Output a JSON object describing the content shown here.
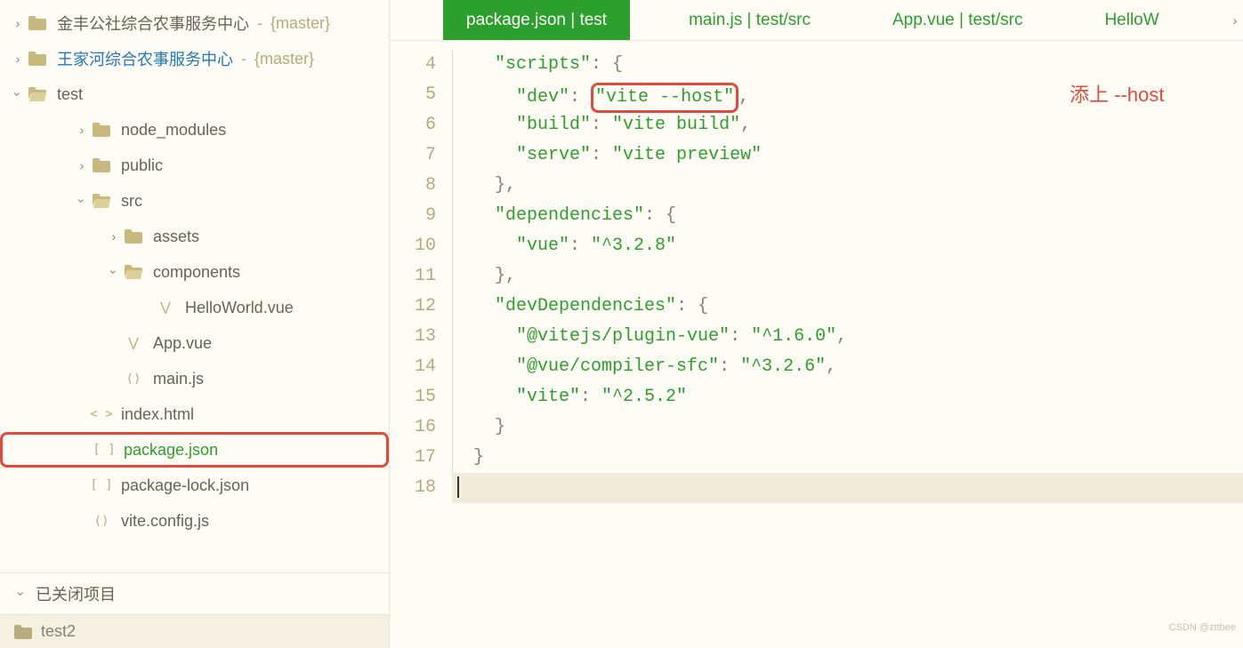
{
  "sidebar": {
    "projects": [
      {
        "name": "金丰公社综合农事服务中心",
        "branch": "{master}",
        "collapsed": true,
        "blue": false
      },
      {
        "name": "王家河综合农事服务中心",
        "branch": "{master}",
        "collapsed": true,
        "blue": true
      }
    ],
    "openProject": {
      "name": "test",
      "children": [
        {
          "name": "node_modules",
          "type": "folder",
          "indent": 2,
          "collapsed": true
        },
        {
          "name": "public",
          "type": "folder",
          "indent": 2,
          "collapsed": true
        },
        {
          "name": "src",
          "type": "folder",
          "indent": 2,
          "collapsed": false,
          "children": [
            {
              "name": "assets",
              "type": "folder",
              "indent": 3,
              "collapsed": true
            },
            {
              "name": "components",
              "type": "folder",
              "indent": 3,
              "collapsed": false,
              "children": [
                {
                  "name": "HelloWorld.vue",
                  "type": "vue",
                  "indent": 4
                }
              ]
            },
            {
              "name": "App.vue",
              "type": "vue",
              "indent": 3
            },
            {
              "name": "main.js",
              "type": "js",
              "indent": 3
            }
          ]
        },
        {
          "name": "index.html",
          "type": "html",
          "indent": 2
        },
        {
          "name": "package.json",
          "type": "json",
          "indent": 2,
          "selected": true
        },
        {
          "name": "package-lock.json",
          "type": "json",
          "indent": 2
        },
        {
          "name": "vite.config.js",
          "type": "js",
          "indent": 2
        }
      ]
    },
    "closedProjectsLabel": "已关闭项目",
    "closedProjects": [
      {
        "name": "test2"
      }
    ]
  },
  "tabs": [
    {
      "label": "package.json | test",
      "active": true
    },
    {
      "label": "main.js | test/src",
      "active": false
    },
    {
      "label": "App.vue | test/src",
      "active": false
    },
    {
      "label": "HelloW",
      "active": false
    }
  ],
  "code": {
    "startLine": 4,
    "lines": [
      {
        "n": 4,
        "indent": 2,
        "content": [
          {
            "t": "key",
            "v": "\"scripts\""
          },
          {
            "t": "punc",
            "v": ": {"
          }
        ]
      },
      {
        "n": 5,
        "indent": 3,
        "content": [
          {
            "t": "key",
            "v": "\"dev\""
          },
          {
            "t": "punc",
            "v": ": "
          },
          {
            "t": "hi",
            "v": "\"vite --host\""
          },
          {
            "t": "punc",
            "v": ","
          }
        ],
        "annotation": "添上 --host"
      },
      {
        "n": 6,
        "indent": 3,
        "content": [
          {
            "t": "key",
            "v": "\"build\""
          },
          {
            "t": "punc",
            "v": ": "
          },
          {
            "t": "str",
            "v": "\"vite build\""
          },
          {
            "t": "punc",
            "v": ","
          }
        ]
      },
      {
        "n": 7,
        "indent": 3,
        "content": [
          {
            "t": "key",
            "v": "\"serve\""
          },
          {
            "t": "punc",
            "v": ": "
          },
          {
            "t": "str",
            "v": "\"vite preview\""
          }
        ]
      },
      {
        "n": 8,
        "indent": 2,
        "content": [
          {
            "t": "punc",
            "v": "},"
          }
        ]
      },
      {
        "n": 9,
        "indent": 2,
        "content": [
          {
            "t": "key",
            "v": "\"dependencies\""
          },
          {
            "t": "punc",
            "v": ": {"
          }
        ]
      },
      {
        "n": 10,
        "indent": 3,
        "content": [
          {
            "t": "key",
            "v": "\"vue\""
          },
          {
            "t": "punc",
            "v": ": "
          },
          {
            "t": "str",
            "v": "\"^3.2.8\""
          }
        ]
      },
      {
        "n": 11,
        "indent": 2,
        "content": [
          {
            "t": "punc",
            "v": "},"
          }
        ]
      },
      {
        "n": 12,
        "indent": 2,
        "content": [
          {
            "t": "key",
            "v": "\"devDependencies\""
          },
          {
            "t": "punc",
            "v": ": {"
          }
        ]
      },
      {
        "n": 13,
        "indent": 3,
        "content": [
          {
            "t": "key",
            "v": "\"@vitejs/plugin-vue\""
          },
          {
            "t": "punc",
            "v": ": "
          },
          {
            "t": "str",
            "v": "\"^1.6.0\""
          },
          {
            "t": "punc",
            "v": ","
          }
        ]
      },
      {
        "n": 14,
        "indent": 3,
        "content": [
          {
            "t": "key",
            "v": "\"@vue/compiler-sfc\""
          },
          {
            "t": "punc",
            "v": ": "
          },
          {
            "t": "str",
            "v": "\"^3.2.6\""
          },
          {
            "t": "punc",
            "v": ","
          }
        ]
      },
      {
        "n": 15,
        "indent": 3,
        "content": [
          {
            "t": "key",
            "v": "\"vite\""
          },
          {
            "t": "punc",
            "v": ": "
          },
          {
            "t": "str",
            "v": "\"^2.5.2\""
          }
        ]
      },
      {
        "n": 16,
        "indent": 2,
        "content": [
          {
            "t": "punc",
            "v": "}"
          }
        ]
      },
      {
        "n": 17,
        "indent": 1,
        "content": [
          {
            "t": "punc",
            "v": "}"
          }
        ]
      },
      {
        "n": 18,
        "indent": 0,
        "content": [],
        "current": true
      }
    ],
    "indentUnit": "  "
  },
  "watermark": "CSDN @zttbee"
}
